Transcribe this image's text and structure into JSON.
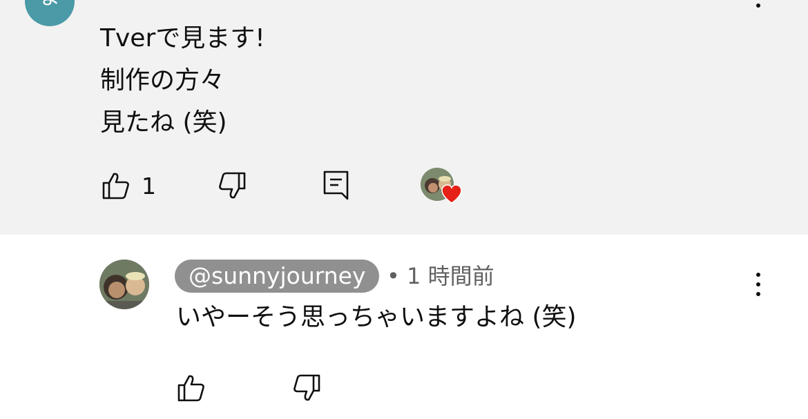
{
  "top_comment": {
    "avatar_letter": "ま",
    "lines": [
      "Tverで見ます!",
      "制作の方々",
      "見たね (笑)"
    ],
    "like_count": "1"
  },
  "reply": {
    "handle": "@sunnyjourney",
    "separator": "•",
    "time": "1 時間前",
    "text": "いやーそう思っちゃいますよね (笑)"
  },
  "colors": {
    "top_background": "#f2f2f2",
    "avatar_teal": "#4a9aa8",
    "handle_pill": "#909090",
    "heart": "#e62117"
  },
  "icons": {
    "like": "thumbs-up-icon",
    "dislike": "thumbs-down-icon",
    "reply": "comment-reply-icon",
    "more": "more-vert-icon",
    "creator_heart": "heart-icon"
  }
}
